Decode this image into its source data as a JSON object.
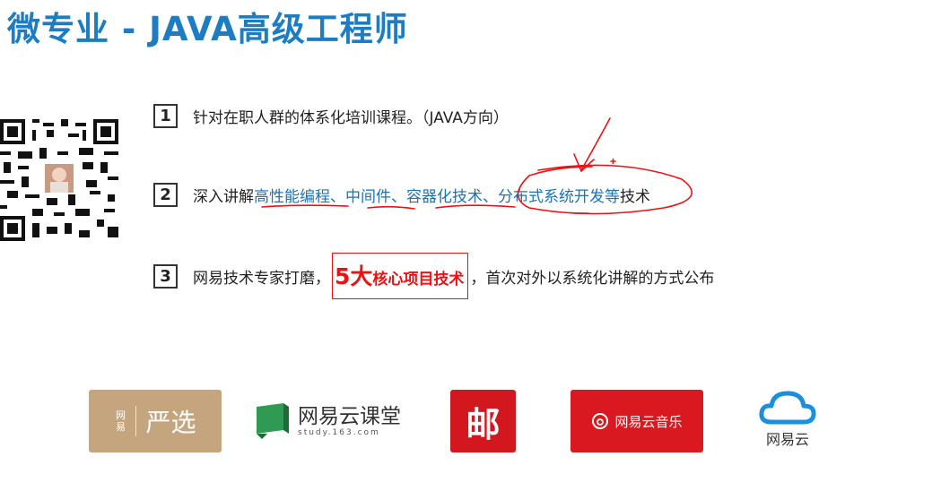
{
  "title": "微专业 - JAVA高级工程师",
  "items": [
    {
      "num": "1",
      "text": "针对在职人群的体系化培训课程。（JAVA方向）"
    },
    {
      "num": "2",
      "prefix": "深入讲解",
      "p1": "高性能编程",
      "s1": "、",
      "p2": "中间件",
      "s2": "、",
      "p3": "容器化技术",
      "s3": "、",
      "p4": "分布式系统开发等",
      "suffix": "技术"
    },
    {
      "num": "3",
      "prefix": "网易技术专家打磨，",
      "big": "5大",
      "highlight": "核心项目技术",
      "suffix": "，首次对外以系统化讲解的方式公布"
    }
  ],
  "logos": {
    "yanxuan": {
      "small": "网易",
      "big": "严选"
    },
    "study": {
      "main": "网易云课堂",
      "sub": "study.163.com"
    },
    "mail": {
      "char": "邮"
    },
    "music": {
      "text": "网易云音乐"
    },
    "cloud": {
      "text": "网易云"
    }
  },
  "colors": {
    "title": "#1d7cc2",
    "accent": "#e11111",
    "link": "#1a73b5"
  }
}
